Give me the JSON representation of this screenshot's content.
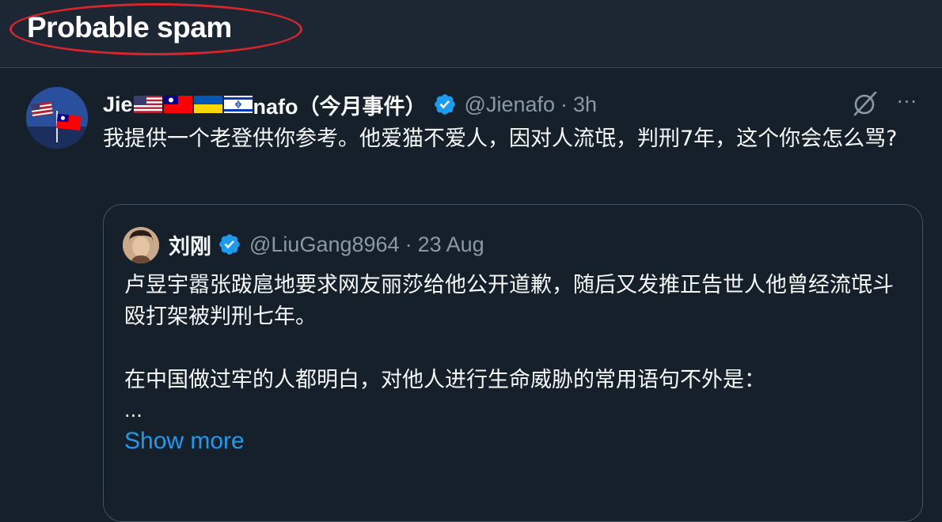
{
  "header": {
    "title": "Probable spam"
  },
  "tweet": {
    "name_prefix": "Jie",
    "name_suffix": "nafo（今月事件）",
    "handle": "@Jienafo",
    "dot": "·",
    "time": "3h",
    "text": "我提供一个老登供你参考。他爱猫不爱人，因对人流氓，判刑7年，这个你会怎么骂?",
    "more_glyph": "···"
  },
  "quote": {
    "name": "刘刚",
    "handle": "@LiuGang8964",
    "dot": "·",
    "time": "23 Aug",
    "line1": "卢昱宇嚣张跋扈地要求网友丽莎给他公开道歉，随后又发推正告世人他曾经流氓斗殴打架被判刑七年。",
    "line2": "在中国做过牢的人都明白，对他人进行生命威胁的常用语句不外是：",
    "ellipsis": "...",
    "show_more": "Show more"
  },
  "colors": {
    "background": "#15202b",
    "header_bg": "#1c2733",
    "accent_blue": "#1d9bf0",
    "secondary_text": "#8b98a5",
    "highlight_red": "#d7262b"
  },
  "icons": [
    "us-flag-icon",
    "taiwan-flag-icon",
    "ukraine-flag-icon",
    "israel-flag-icon",
    "verified-badge-icon",
    "grok-icon",
    "more-options-icon"
  ]
}
